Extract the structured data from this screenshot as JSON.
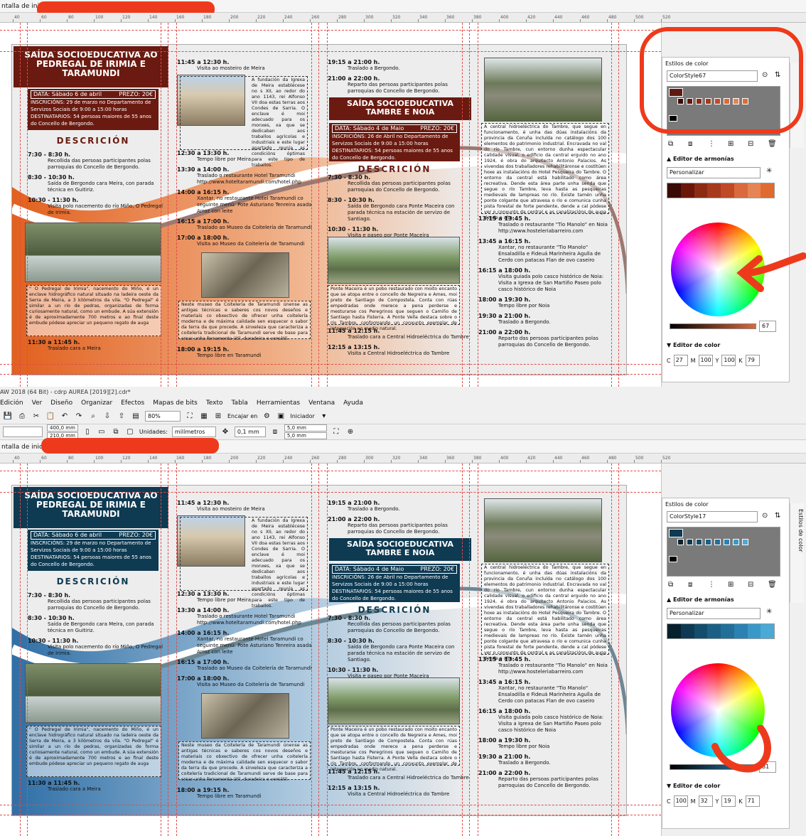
{
  "top": {
    "tab_label": "ntalla de inicio",
    "ruler_ticks": [
      "40",
      "60",
      "80",
      "100",
      "120",
      "140",
      "160",
      "180",
      "200",
      "220",
      "240",
      "260",
      "280",
      "300",
      "320",
      "340",
      "360",
      "380",
      "400",
      "420",
      "440",
      "460",
      "480",
      "500",
      "520"
    ]
  },
  "bottom": {
    "window_title": "AW 2018 (64 Bit) - cdrp AUREA [2019][2].cdr*",
    "menu": [
      "Edición",
      "Ver",
      "Diseño",
      "Organizar",
      "Efectos",
      "Mapas de bits",
      "Texto",
      "Tabla",
      "Herramientas",
      "Ventana",
      "Ayuda"
    ],
    "zoom": "80%",
    "fit_label": "Encajar en",
    "start_label": "Iniciador",
    "width": "400,0 mm",
    "height": "210,0 mm",
    "units_label": "Unidades:",
    "units_value": "milímetros",
    "nudge": "0,1 mm",
    "dup_x": "5,0 mm",
    "dup_y": "5,0 mm",
    "tab_label": "ntalla de inicio",
    "ruler_ticks": [
      "40",
      "60",
      "80",
      "100",
      "120",
      "140",
      "160",
      "180",
      "200",
      "220",
      "240",
      "260",
      "280",
      "300",
      "320",
      "340",
      "360",
      "380",
      "400",
      "420",
      "440",
      "460",
      "480",
      "500",
      "520"
    ]
  },
  "brochure": {
    "title1": "SAÍDA SOCIOEDUCATIVA AO PEDREGAL DE IRIMIA E TARAMUNDI",
    "date1": "DATA: Sábado 6 de abril",
    "price": "PREZO: 20€",
    "info1": "INSCRICIÓNS: 29 de marzo no Departamento de Servizos Sociais de 9:00 a 15:00 horas",
    "dest": "DESTINATARIOS: 54 persoas maiores de 55 anos do Concello de Bergondo.",
    "desc": "DESCRICIÓN",
    "sched1": [
      {
        "t": "7:30 - 8:30 h.",
        "d": "Recollida das persoas participantes polas parroquias do Concello de Bergondo."
      },
      {
        "t": "8:30 - 10:30 h.",
        "d": "Saída de Bergondo cara Meira, con parada técnica en Guitiriz."
      },
      {
        "t": "10:30 - 11:30 h.",
        "d": "Visita polo nacemento do río Miño, O Pedregal de Irimia."
      }
    ],
    "pedregal": "\" O Pedregal de Irimia\", nacemento do Miño, é un enclave hidrográfico natural situado na ladeira oeste da Serra de Meira, a 3 kilómetros da vila. \"O Pedregal\" é similar a un río de pedras, organizadas de forma curiosamente natural, como un embude. A súa extensión é de aproximadamente 700 metros e ao final deste embude pódese apreciar un pequeno regato de auga",
    "sched1_end": {
      "t": "11:30 a 11:45 h.",
      "d": "Traslado cara a Meira"
    },
    "sched2": [
      {
        "t": "11:45 a 12:30 h.",
        "d": "Visita ao mosteiro de Meira"
      },
      {
        "t": "12:30 a 13:30 h.",
        "d": "Tempo libre por Meira"
      },
      {
        "t": "13:30 a 14:00 h.",
        "d": "Traslado o restaurante Hotel Taramundi http://www.hoteltaramundi.com/hotel.php"
      },
      {
        "t": "14:00 a 16:15 h.",
        "d": "Xantar, no restaurante Hotel Taramundi co seguinte menú: Pote Asturiano Tenreira asada Arroz con leite"
      },
      {
        "t": "16:15 a 17:00 h.",
        "d": "Traslado ao Museo da Coitelería de Taramundi"
      },
      {
        "t": "17:00 a 18:00 h.",
        "d": "Visita ao Museo da Coitelería de Taramundi"
      }
    ],
    "meira": "A fundación da Igrexa de Meira establécese no s XII, ao redor do ano 1143, rei Alfonso VII doa estas terras aos Condes de Sarria. O enclave é moi adecuado para os monxes, xa que se dedicaban aos traballos agrícolas e industriais e este lugar apartado reunía as condicións óptimas para este tipo de traballos.",
    "museo": "Neste museo da Coitelería de Taramundi únense as antigas técnicas e saberes cos novos deseños e materiais co obxectivo de ofrecer unha coitelería moderna e de máxima calidade sen esquecer o sabor da terra da que procede. A sinxeleza que caracteriza a coitelería tradicional de Taramundi serve de base para crear unha ferramenta útil, duradeira e versátil.",
    "sched2_end": {
      "t": "18:00 a 19:15 h.",
      "d": "Tempo libre en Taramundi"
    },
    "sched3_top": [
      {
        "t": "19:15 a 21:00 h.",
        "d": "Traslado a Bergondo."
      },
      {
        "t": "21:00 a 22:00 h.",
        "d": "Reparto das persoas participantes polas parroquias do Concello de Bergondo."
      }
    ],
    "title2": "SAÍDA SOCIOEDUCATIVA TAMBRE E NOIA",
    "date2": "DATA: Sábado 4 de Maio",
    "info2": "INSCRICIÓNS: 26 de Abril no Departamento de Servizos Sociais de 9:00 a 15:00 horas",
    "sched3": [
      {
        "t": "7:30 - 8:30 h.",
        "d": "Recollida das persoas participantes polas parroquias do Concello de Bergondo."
      },
      {
        "t": "8:30 - 10:30 h.",
        "d": "Saída de Bergondo cara Ponte Maceira con parada técnica na estación de servizo de Santiago."
      },
      {
        "t": "10:30 - 11:30 h.",
        "d": "Visita e paseo por Ponte Maceira"
      }
    ],
    "maceira": "Ponte Maceira é un pobo restaurado con moito encanto que se atopa entre o concello de Negreira e Ames, moi preto de Santiago de Compostela. Conta con rúas empedradas onde merece a pena perderse e mesturarse cos Peregrinos que seguen o Camiño de Santiago hasta Fisterra. A Ponte Vella destaca sobre o río Tambre, conformando un conxunto exemplar de integración no medio natural.",
    "sched3_end": [
      {
        "t": "11:45 a 12:15 h.",
        "d": "Traslado cara a Central Hidroeléctrica do Tambre"
      },
      {
        "t": "12:15 a 13:15 h.",
        "d": "Visita a Central Hidroeléctrica do Tambre"
      }
    ],
    "central": "A central hidroeléctrica do Tambre, que segue en funcionamento, é unha das dúas instalacións da provincia da Coruña incluída no catálogo dos 100 elementos do patrimonio industrial. Encravada no val do río Tambre, cun entorno dunha espectacular calidade visual, o edificio da central erguido no ano 1924, é obra do arquitecto Antonio Palacios. As vivendas dos traballadores rehabilitáronse e costitúen hoxe as instalacións do Hotel Pesqueira do Tambre. O entorno da central está habilitado como área recreativa. Dende esta área parte unha senda que segue o río Tambre, leva hasta as pesqueiras medievais de lampreas no río. Existe tamén unha ponte colgante que atravesa o río e comunica cunha pista forestal de forte pendente, dende a cal pódese ver o conxunto da central e as canalizacións de auga dende o alto.",
    "sched4": [
      {
        "t": "13:15 a 13:45 h.",
        "d": "Traslado o restaurante \"Tio Manolo\" en Noia http://www.hosteleriabarreiro.com"
      },
      {
        "t": "13:45 a 16:15 h.",
        "d": "Xantar, no restaurante \"Tio Manolo\" Ensaladilla e Fideuá Marinheira Agulla de Cerdo con patacas Flan de ovo caseiro"
      },
      {
        "t": "16:15 a 18:00 h.",
        "d": "Visita guiada polo casco histórico de Noia: Visita a Igrexa de San Martiño Paseo polo casco histórico de Noia"
      },
      {
        "t": "18:00 a 19:30 h.",
        "d": "Tempo libre por Noia"
      },
      {
        "t": "19:30 a 21:00 h.",
        "d": "Traslado a Bergondo."
      },
      {
        "t": "21:00 a 22:00 h.",
        "d": "Reparto das persoas participantes polas parroquias do Concello de Bergondo."
      }
    ]
  },
  "docker_top": {
    "title": "Estilos de color",
    "style_name": "ColorStyle67",
    "harmony_label": "Editor de armonías",
    "custom_label": "Personalizar",
    "editor_label": "Editor de color",
    "tab_label": "Estilos de c",
    "slider_value": "67",
    "c": "27",
    "m": "100",
    "y": "100",
    "k": "79",
    "harmony_colors": [
      "#3a0a05",
      "#6b160a",
      "#8c2b14",
      "#a53a1c",
      "#c04a25",
      "#d96a3c",
      "#e58556",
      "#e06b30"
    ],
    "main_color": "#5e1a10"
  },
  "docker_bottom": {
    "title": "Estilos de color",
    "style_name": "ColorStyle17",
    "harmony_label": "Editor de armonías",
    "custom_label": "Personalizar",
    "editor_label": "Editor de color",
    "tab_label": "Estilos de color",
    "slider_value": "81",
    "c": "100",
    "m": "32",
    "y": "19",
    "k": "71",
    "harmony_colors": [
      "#07202e",
      "#0d3a52",
      "#144d6c",
      "#1b5f85",
      "#226f9a",
      "#2b82b2",
      "#3a98c8",
      "#4aa9d6"
    ],
    "main_color": "#0e3a52"
  },
  "labels": {
    "c": "C",
    "m": "M",
    "y": "Y",
    "k": "K"
  }
}
